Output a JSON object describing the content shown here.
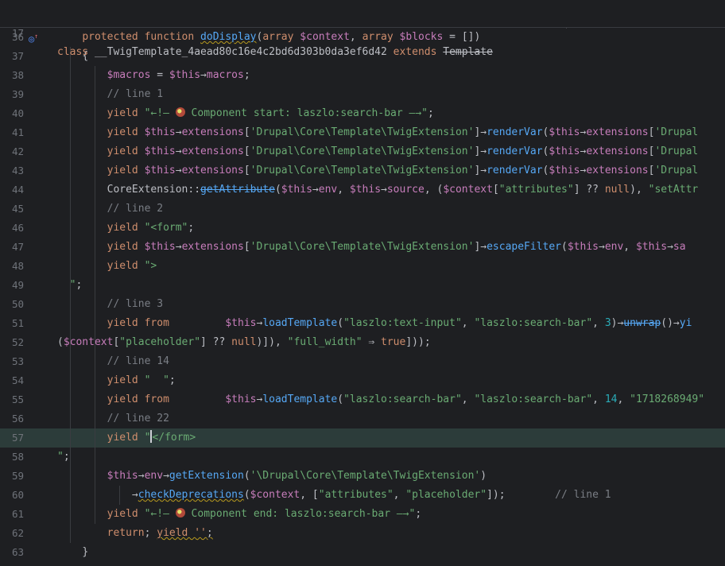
{
  "sticky": {
    "line_number": "17",
    "kw_class": "class",
    "class_name": "__TwigTemplate_4aead80c16e4c2bd6d303b0da3ef6d42",
    "kw_extends": "extends",
    "parent_class": "Template"
  },
  "icons": {
    "override": "override-marker-icon",
    "component": "component-emoji-icon"
  },
  "colors": {
    "background": "#1e1f22",
    "keyword": "#cf8e6d",
    "function": "#56a8f5",
    "variable": "#c77dbb",
    "string": "#6aab73",
    "comment": "#7a7e85",
    "number": "#2aacb8",
    "line_number": "#6f737a",
    "highlight": "#2c3c3a"
  },
  "lines": [
    {
      "n": "36",
      "indent": 1,
      "tokens": [
        [
          "kw",
          "protected "
        ],
        [
          "kw",
          "function "
        ],
        [
          "fn sq",
          "doDisplay"
        ],
        [
          "",
          "("
        ],
        [
          "kw",
          "array "
        ],
        [
          "var",
          "$context"
        ],
        [
          "",
          ", "
        ],
        [
          "kw",
          "array "
        ],
        [
          "var",
          "$blocks"
        ],
        [
          "",
          " = [])"
        ]
      ]
    },
    {
      "n": "37",
      "indent": 1,
      "tokens": [
        [
          "",
          "{"
        ]
      ]
    },
    {
      "n": "38",
      "indent": 2,
      "tokens": [
        [
          "var",
          "$macros"
        ],
        [
          "",
          " = "
        ],
        [
          "var",
          "$this"
        ],
        [
          "",
          "→"
        ],
        [
          "var",
          "macros"
        ],
        [
          "",
          ";"
        ]
      ]
    },
    {
      "n": "39",
      "indent": 2,
      "tokens": [
        [
          "cm",
          "// line 1"
        ]
      ]
    },
    {
      "n": "40",
      "indent": 2,
      "tokens": [
        [
          "kw",
          "yield "
        ],
        [
          "str",
          "\"←!— "
        ],
        [
          "emoji",
          ""
        ],
        [
          "str",
          " Component start: laszlo:search-bar —→\""
        ],
        [
          "",
          ";"
        ]
      ]
    },
    {
      "n": "41",
      "indent": 2,
      "tokens": [
        [
          "kw",
          "yield "
        ],
        [
          "var",
          "$this"
        ],
        [
          "",
          "→"
        ],
        [
          "var",
          "extensions"
        ],
        [
          "",
          "["
        ],
        [
          "str",
          "'Drupal\\Core\\Template\\TwigExtension'"
        ],
        [
          "",
          "]→"
        ],
        [
          "fn",
          "renderVar"
        ],
        [
          "",
          "("
        ],
        [
          "var",
          "$this"
        ],
        [
          "",
          "→"
        ],
        [
          "var",
          "extensions"
        ],
        [
          "",
          "["
        ],
        [
          "str",
          "'Drupal"
        ]
      ]
    },
    {
      "n": "42",
      "indent": 2,
      "tokens": [
        [
          "kw",
          "yield "
        ],
        [
          "var",
          "$this"
        ],
        [
          "",
          "→"
        ],
        [
          "var",
          "extensions"
        ],
        [
          "",
          "["
        ],
        [
          "str",
          "'Drupal\\Core\\Template\\TwigExtension'"
        ],
        [
          "",
          "]→"
        ],
        [
          "fn",
          "renderVar"
        ],
        [
          "",
          "("
        ],
        [
          "var",
          "$this"
        ],
        [
          "",
          "→"
        ],
        [
          "var",
          "extensions"
        ],
        [
          "",
          "["
        ],
        [
          "str",
          "'Drupal"
        ]
      ]
    },
    {
      "n": "43",
      "indent": 2,
      "tokens": [
        [
          "kw",
          "yield "
        ],
        [
          "var",
          "$this"
        ],
        [
          "",
          "→"
        ],
        [
          "var",
          "extensions"
        ],
        [
          "",
          "["
        ],
        [
          "str",
          "'Drupal\\Core\\Template\\TwigExtension'"
        ],
        [
          "",
          "]→"
        ],
        [
          "fn",
          "renderVar"
        ],
        [
          "",
          "("
        ],
        [
          "var",
          "$this"
        ],
        [
          "",
          "→"
        ],
        [
          "var",
          "extensions"
        ],
        [
          "",
          "["
        ],
        [
          "str",
          "'Drupal"
        ]
      ]
    },
    {
      "n": "44",
      "indent": 2,
      "tokens": [
        [
          "cls",
          "CoreExtension"
        ],
        [
          "",
          "::"
        ],
        [
          "fn st",
          "getAttribute"
        ],
        [
          "",
          "("
        ],
        [
          "var",
          "$this"
        ],
        [
          "",
          "→"
        ],
        [
          "var",
          "env"
        ],
        [
          "",
          ", "
        ],
        [
          "var",
          "$this"
        ],
        [
          "",
          "→"
        ],
        [
          "var",
          "source"
        ],
        [
          "",
          ", ("
        ],
        [
          "var",
          "$context"
        ],
        [
          "",
          "["
        ],
        [
          "str",
          "\"attributes\""
        ],
        [
          "",
          "] ?? "
        ],
        [
          "kw",
          "null"
        ],
        [
          "",
          "), "
        ],
        [
          "str",
          "\"setAttr"
        ]
      ]
    },
    {
      "n": "45",
      "indent": 2,
      "tokens": [
        [
          "cm",
          "// line 2"
        ]
      ]
    },
    {
      "n": "46",
      "indent": 2,
      "tokens": [
        [
          "kw",
          "yield "
        ],
        [
          "str",
          "\"<form\""
        ],
        [
          "",
          ";"
        ]
      ]
    },
    {
      "n": "47",
      "indent": 2,
      "tokens": [
        [
          "kw",
          "yield "
        ],
        [
          "var",
          "$this"
        ],
        [
          "",
          "→"
        ],
        [
          "var",
          "extensions"
        ],
        [
          "",
          "["
        ],
        [
          "str",
          "'Drupal\\Core\\Template\\TwigExtension'"
        ],
        [
          "",
          "]→"
        ],
        [
          "fn",
          "escapeFilter"
        ],
        [
          "",
          "("
        ],
        [
          "var",
          "$this"
        ],
        [
          "",
          "→"
        ],
        [
          "var",
          "env"
        ],
        [
          "",
          ", "
        ],
        [
          "var",
          "$this"
        ],
        [
          "",
          "→"
        ],
        [
          "var",
          "sa"
        ]
      ]
    },
    {
      "n": "48",
      "indent": 2,
      "tokens": [
        [
          "kw",
          "yield "
        ],
        [
          "str",
          "\">"
        ]
      ]
    },
    {
      "n": "49",
      "indent": 0,
      "tokens": [
        [
          "str",
          "  \""
        ],
        [
          "",
          ";"
        ]
      ]
    },
    {
      "n": "50",
      "indent": 2,
      "tokens": [
        [
          "cm",
          "// line 3"
        ]
      ]
    },
    {
      "n": "51",
      "indent": 2,
      "tokens": [
        [
          "kw",
          "yield from "
        ],
        [
          "",
          "        "
        ],
        [
          "var",
          "$this"
        ],
        [
          "",
          "→"
        ],
        [
          "fn",
          "loadTemplate"
        ],
        [
          "",
          "("
        ],
        [
          "str",
          "\"laszlo:text-input\""
        ],
        [
          "",
          ", "
        ],
        [
          "str",
          "\"laszlo:search-bar\""
        ],
        [
          "",
          ", "
        ],
        [
          "num",
          "3"
        ],
        [
          "",
          ")→"
        ],
        [
          "fn st",
          "unwrap"
        ],
        [
          "",
          "()→"
        ],
        [
          "fn",
          "yi"
        ]
      ]
    },
    {
      "n": "52",
      "indent": 0,
      "tokens": [
        [
          "",
          "("
        ],
        [
          "var",
          "$context"
        ],
        [
          "",
          "["
        ],
        [
          "str",
          "\"placeholder\""
        ],
        [
          "",
          "] ?? "
        ],
        [
          "kw",
          "null"
        ],
        [
          "",
          ")]), "
        ],
        [
          "str",
          "\"full_width\""
        ],
        [
          "",
          " ⇒ "
        ],
        [
          "kw",
          "true"
        ],
        [
          "",
          "]));"
        ]
      ]
    },
    {
      "n": "53",
      "indent": 2,
      "tokens": [
        [
          "cm",
          "// line 14"
        ]
      ]
    },
    {
      "n": "54",
      "indent": 2,
      "tokens": [
        [
          "kw",
          "yield "
        ],
        [
          "str",
          "\"  \""
        ],
        [
          "",
          ";"
        ]
      ]
    },
    {
      "n": "55",
      "indent": 2,
      "tokens": [
        [
          "kw",
          "yield from "
        ],
        [
          "",
          "        "
        ],
        [
          "var",
          "$this"
        ],
        [
          "",
          "→"
        ],
        [
          "fn",
          "loadTemplate"
        ],
        [
          "",
          "("
        ],
        [
          "str",
          "\"laszlo:search-bar\""
        ],
        [
          "",
          ", "
        ],
        [
          "str",
          "\"laszlo:search-bar\""
        ],
        [
          "",
          ", "
        ],
        [
          "num",
          "14"
        ],
        [
          "",
          ", "
        ],
        [
          "str",
          "\"1718268949\""
        ]
      ]
    },
    {
      "n": "56",
      "indent": 2,
      "tokens": [
        [
          "cm",
          "// line 22"
        ]
      ]
    },
    {
      "n": "57",
      "indent": 2,
      "hl": true,
      "tokens": [
        [
          "kw",
          "yield "
        ],
        [
          "str",
          "\""
        ],
        [
          "cursor",
          ""
        ],
        [
          "str",
          "</form>"
        ]
      ]
    },
    {
      "n": "58",
      "indent": 0,
      "tokens": [
        [
          "str",
          "\""
        ],
        [
          "",
          ";"
        ]
      ]
    },
    {
      "n": "59",
      "indent": 2,
      "tokens": [
        [
          "var",
          "$this"
        ],
        [
          "",
          "→"
        ],
        [
          "var",
          "env"
        ],
        [
          "",
          "→"
        ],
        [
          "fn",
          "getExtension"
        ],
        [
          "",
          "("
        ],
        [
          "str",
          "'\\Drupal\\Core\\Template\\TwigExtension'"
        ],
        [
          "",
          ")"
        ]
      ]
    },
    {
      "n": "60",
      "indent": 3,
      "tokens": [
        [
          "",
          "→"
        ],
        [
          "fn sq",
          "checkDeprecations"
        ],
        [
          "",
          "("
        ],
        [
          "var",
          "$context"
        ],
        [
          "",
          ", ["
        ],
        [
          "str",
          "\"attributes\""
        ],
        [
          "",
          ", "
        ],
        [
          "str",
          "\"placeholder\""
        ],
        [
          "",
          "]);        "
        ],
        [
          "cm",
          "// line 1"
        ]
      ]
    },
    {
      "n": "61",
      "indent": 2,
      "tokens": [
        [
          "kw",
          "yield "
        ],
        [
          "str",
          "\"←!— "
        ],
        [
          "emoji",
          ""
        ],
        [
          "str",
          " Component end: laszlo:search-bar —→\""
        ],
        [
          "",
          ";"
        ]
      ]
    },
    {
      "n": "62",
      "indent": 2,
      "tokens": [
        [
          "kw",
          "return"
        ],
        [
          "",
          "; "
        ],
        [
          "kw sq",
          "yield ''"
        ],
        [
          "sq",
          ";"
        ]
      ]
    },
    {
      "n": "63",
      "indent": 1,
      "tokens": [
        [
          "",
          "}"
        ]
      ]
    }
  ]
}
